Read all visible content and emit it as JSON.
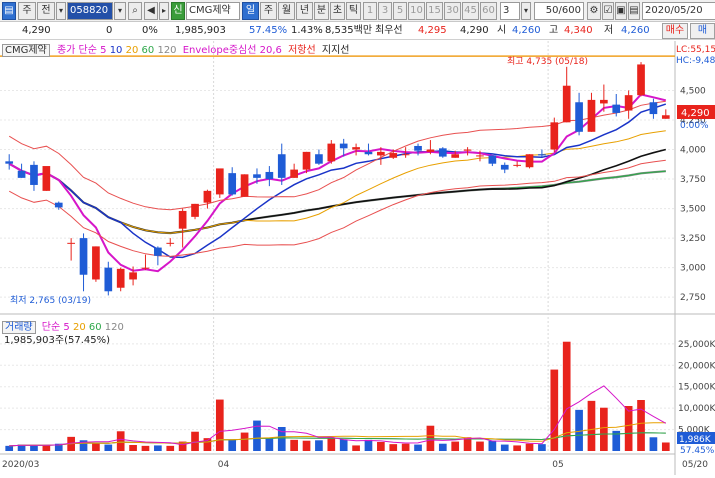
{
  "toolbar": {
    "menu1": "주",
    "menu2": "전",
    "code": "058820",
    "badge": "신",
    "stock_name": "CMG제약",
    "periods": [
      "일",
      "주",
      "월",
      "년",
      "분",
      "초",
      "틱"
    ],
    "active_period": "일",
    "intervals": [
      "1",
      "3",
      "5",
      "10",
      "15",
      "30",
      "45",
      "60"
    ],
    "interval_select": "3",
    "count": "50",
    "count_total": "/600",
    "date": "2020/05/20"
  },
  "info": {
    "price": "4,290",
    "change": "0",
    "change_pct": "0%",
    "volume": "1,985,903",
    "turnover_pct": "57.45%",
    "turnover_label": "1.43%",
    "foreign": "8,535백만",
    "prev_label": "최우선",
    "prev_value": "4,295",
    "bid": "4,290",
    "open_label": "시",
    "open": "4,260",
    "high_label": "고",
    "high": "4,340",
    "low_label": "저",
    "low": "4,260",
    "buy_button": "매수",
    "sell_button": "매"
  },
  "price_legend": {
    "name": "CMG제약",
    "ma_label": "종가 단순",
    "ma_periods": [
      "5",
      "10",
      "20",
      "60",
      "120"
    ],
    "envelope": "Envelope중심선 20,6",
    "resistance": "저항선",
    "support": "지지선",
    "lc": "LC:55,15",
    "hc": "HC:-9,48"
  },
  "volume_legend": {
    "label": "거래량",
    "ma_label": "단순",
    "ma_periods": [
      "5",
      "20",
      "60",
      "120"
    ],
    "value": "1,985,903주(57.45%)"
  },
  "annotations": {
    "high": "최고 4,735 (05/18)",
    "low": "최저 2,765 (03/19)",
    "current_price": "4,290",
    "current_pct": "0.00%",
    "current_volume": "1,986K",
    "current_volume_pct": "57.45%"
  },
  "colors": {
    "up": "#e8231c",
    "down": "#1f5cd6",
    "ma5": "#d616c9",
    "ma10": "#1a34c8",
    "ma20": "#e8a000",
    "ma60": "#2ea84a",
    "ma120": "#888888"
  },
  "chart_data": {
    "type": "candlestick",
    "price_ticks": [
      "4,500",
      "4,250",
      "4,000",
      "3,750",
      "3,500",
      "3,250",
      "3,000",
      "2,750"
    ],
    "volume_ticks": [
      "25,000K",
      "20,000K",
      "15,000K",
      "10,000K",
      "5,000K"
    ],
    "x_labels": [
      "2020/03",
      "04",
      "05",
      "05/20"
    ],
    "candles": [
      {
        "o": 3900,
        "h": 3960,
        "l": 3830,
        "c": 3880,
        "v": 1200
      },
      {
        "o": 3820,
        "h": 3880,
        "l": 3760,
        "c": 3760,
        "v": 1500
      },
      {
        "o": 3870,
        "h": 3900,
        "l": 3650,
        "c": 3700,
        "v": 1300
      },
      {
        "o": 3650,
        "h": 3820,
        "l": 3650,
        "c": 3860,
        "v": 1400
      },
      {
        "o": 3550,
        "h": 3560,
        "l": 3490,
        "c": 3510,
        "v": 1700
      },
      {
        "o": 3210,
        "h": 3250,
        "l": 3060,
        "c": 3210,
        "v": 3300
      },
      {
        "o": 3250,
        "h": 3290,
        "l": 2800,
        "c": 2940,
        "v": 2500
      },
      {
        "o": 2900,
        "h": 3180,
        "l": 2880,
        "c": 3180,
        "v": 1800
      },
      {
        "o": 3000,
        "h": 3050,
        "l": 2765,
        "c": 2800,
        "v": 1500
      },
      {
        "o": 2830,
        "h": 3000,
        "l": 2800,
        "c": 2990,
        "v": 4600
      },
      {
        "o": 2900,
        "h": 3010,
        "l": 2850,
        "c": 2960,
        "v": 1400
      },
      {
        "o": 3000,
        "h": 3110,
        "l": 2980,
        "c": 3000,
        "v": 1200
      },
      {
        "o": 3170,
        "h": 3180,
        "l": 3020,
        "c": 3100,
        "v": 1300
      },
      {
        "o": 3210,
        "h": 3250,
        "l": 3180,
        "c": 3210,
        "v": 1200
      },
      {
        "o": 3330,
        "h": 3500,
        "l": 3170,
        "c": 3480,
        "v": 2200
      },
      {
        "o": 3430,
        "h": 3540,
        "l": 3410,
        "c": 3540,
        "v": 4500
      },
      {
        "o": 3550,
        "h": 3660,
        "l": 3500,
        "c": 3650,
        "v": 3000
      },
      {
        "o": 3620,
        "h": 3830,
        "l": 3590,
        "c": 3840,
        "v": 12000
      },
      {
        "o": 3800,
        "h": 3850,
        "l": 3610,
        "c": 3620,
        "v": 2600
      },
      {
        "o": 3600,
        "h": 3790,
        "l": 3600,
        "c": 3790,
        "v": 4300
      },
      {
        "o": 3790,
        "h": 3840,
        "l": 3710,
        "c": 3760,
        "v": 7100
      },
      {
        "o": 3810,
        "h": 3860,
        "l": 3690,
        "c": 3750,
        "v": 2900
      },
      {
        "o": 3960,
        "h": 4050,
        "l": 3700,
        "c": 3760,
        "v": 5600
      },
      {
        "o": 3760,
        "h": 3880,
        "l": 3760,
        "c": 3830,
        "v": 2600
      },
      {
        "o": 3830,
        "h": 3980,
        "l": 3800,
        "c": 3980,
        "v": 2400
      },
      {
        "o": 3960,
        "h": 4000,
        "l": 3870,
        "c": 3880,
        "v": 2500
      },
      {
        "o": 3900,
        "h": 4080,
        "l": 3880,
        "c": 4050,
        "v": 3100
      },
      {
        "o": 4050,
        "h": 4090,
        "l": 3940,
        "c": 4010,
        "v": 2700
      },
      {
        "o": 4000,
        "h": 4050,
        "l": 3950,
        "c": 4020,
        "v": 1300
      },
      {
        "o": 3980,
        "h": 4050,
        "l": 3950,
        "c": 3960,
        "v": 2600
      },
      {
        "o": 3950,
        "h": 4020,
        "l": 3870,
        "c": 3980,
        "v": 2100
      },
      {
        "o": 3930,
        "h": 4000,
        "l": 3920,
        "c": 3970,
        "v": 1600
      },
      {
        "o": 3960,
        "h": 4020,
        "l": 3930,
        "c": 3960,
        "v": 1700
      },
      {
        "o": 4030,
        "h": 4050,
        "l": 3950,
        "c": 3990,
        "v": 1500
      },
      {
        "o": 3980,
        "h": 4080,
        "l": 3960,
        "c": 4000,
        "v": 5900
      },
      {
        "o": 4010,
        "h": 4020,
        "l": 3930,
        "c": 3940,
        "v": 1700
      },
      {
        "o": 3930,
        "h": 3990,
        "l": 3930,
        "c": 3960,
        "v": 2200
      },
      {
        "o": 3990,
        "h": 4020,
        "l": 3950,
        "c": 4000,
        "v": 3200
      },
      {
        "o": 3950,
        "h": 3990,
        "l": 3900,
        "c": 3950,
        "v": 2200
      },
      {
        "o": 3950,
        "h": 3950,
        "l": 3860,
        "c": 3880,
        "v": 2400
      },
      {
        "o": 3870,
        "h": 3890,
        "l": 3800,
        "c": 3830,
        "v": 1500
      },
      {
        "o": 3870,
        "h": 3900,
        "l": 3850,
        "c": 3870,
        "v": 1300
      },
      {
        "o": 3850,
        "h": 3960,
        "l": 3840,
        "c": 3960,
        "v": 1700
      },
      {
        "o": 3960,
        "h": 4000,
        "l": 3940,
        "c": 3950,
        "v": 1600
      },
      {
        "o": 4000,
        "h": 4270,
        "l": 3980,
        "c": 4230,
        "v": 19000
      },
      {
        "o": 4230,
        "h": 4700,
        "l": 4230,
        "c": 4540,
        "v": 25500
      },
      {
        "o": 4400,
        "h": 4480,
        "l": 4120,
        "c": 4150,
        "v": 9600
      },
      {
        "o": 4150,
        "h": 4480,
        "l": 4150,
        "c": 4420,
        "v": 11700
      },
      {
        "o": 4390,
        "h": 4550,
        "l": 4320,
        "c": 4420,
        "v": 10100
      },
      {
        "o": 4380,
        "h": 4470,
        "l": 4280,
        "c": 4310,
        "v": 4700
      },
      {
        "o": 4330,
        "h": 4500,
        "l": 4260,
        "c": 4460,
        "v": 10500
      },
      {
        "o": 4460,
        "h": 4740,
        "l": 4450,
        "c": 4720,
        "v": 11900
      },
      {
        "o": 4400,
        "h": 4430,
        "l": 4260,
        "c": 4300,
        "v": 3200
      },
      {
        "o": 4260,
        "h": 4340,
        "l": 4260,
        "c": 4290,
        "v": 1986
      }
    ]
  }
}
